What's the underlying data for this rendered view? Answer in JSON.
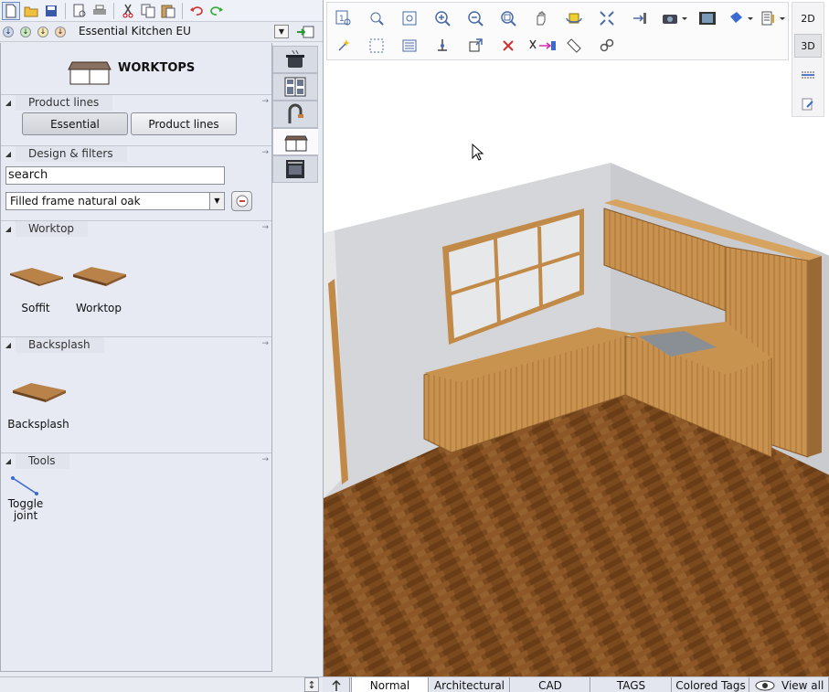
{
  "catalog": {
    "name": "Essential Kitchen EU"
  },
  "panel": {
    "title": "WORKTOPS"
  },
  "sections": {
    "product_lines": "Product lines",
    "design_filters": "Design & filters",
    "worktop": "Worktop",
    "backsplash": "Backsplash",
    "tools": "Tools"
  },
  "product_line_buttons": {
    "essential": "Essential",
    "product_lines": "Product lines"
  },
  "search": {
    "value": "search"
  },
  "filter": {
    "selected": "Filled frame natural oak"
  },
  "worktop_items": [
    {
      "label": "Soffit"
    },
    {
      "label": "Worktop"
    }
  ],
  "backsplash_items": [
    {
      "label": "Backsplash"
    }
  ],
  "tool_items": [
    {
      "label": "Toggle joint"
    }
  ],
  "view_modes": {
    "two_d": "2D",
    "three_d": "3D"
  },
  "bottom_tabs": [
    {
      "label": "Normal",
      "active": true
    },
    {
      "label": "Architectural"
    },
    {
      "label": "CAD"
    },
    {
      "label": "TAGS"
    },
    {
      "label": "Colored Tags"
    },
    {
      "label": "View all"
    }
  ],
  "colors": {
    "accent": "#6a8ac8",
    "wood": "#c8924f",
    "floor": "#7a4a1e",
    "wall": "#d4d6da"
  }
}
